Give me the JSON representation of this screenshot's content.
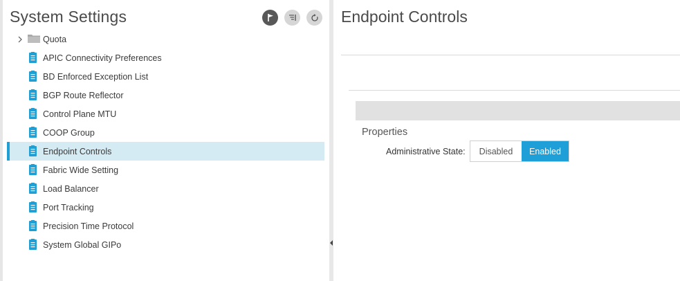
{
  "left_panel": {
    "title": "System Settings",
    "toolbar": [
      {
        "icon": "flag-icon",
        "name": "actions"
      },
      {
        "icon": "filter-icon",
        "name": "filter"
      },
      {
        "icon": "refresh-icon",
        "name": "refresh"
      }
    ],
    "tree": {
      "folder": {
        "label": "Quota",
        "icon": "folder-icon",
        "expanded": false
      },
      "items": [
        {
          "label": "APIC Connectivity Preferences"
        },
        {
          "label": "BD Enforced Exception List"
        },
        {
          "label": "BGP Route Reflector"
        },
        {
          "label": "Control Plane MTU"
        },
        {
          "label": "COOP Group"
        },
        {
          "label": "Endpoint Controls",
          "selected": true
        },
        {
          "label": "Fabric Wide Setting"
        },
        {
          "label": "Load Balancer"
        },
        {
          "label": "Port Tracking"
        },
        {
          "label": "Precision Time Protocol"
        },
        {
          "label": "System Global GIPo"
        }
      ]
    }
  },
  "right_panel": {
    "title": "Endpoint Controls",
    "section_title": "Properties",
    "admin_state": {
      "label": "Administrative State:",
      "options": [
        "Disabled",
        "Enabled"
      ],
      "selected": "Enabled"
    }
  },
  "colors": {
    "accent": "#1e9fd8",
    "selection_bg": "#d4ebf4",
    "policy_icon": "#1f9fd3",
    "toolbar_button_bg": "#d6d6d6",
    "toolbar_primary_bg": "#585858"
  }
}
